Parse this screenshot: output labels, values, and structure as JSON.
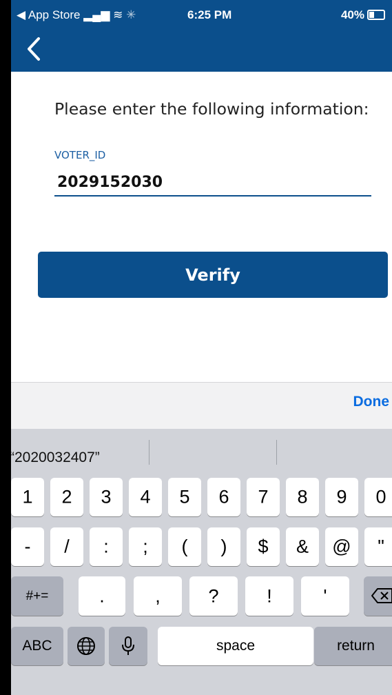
{
  "status_bar": {
    "back_app": "◀ App Store",
    "signal": "▂▄▆ ︎",
    "wifi": "wifi-icon",
    "time": "6:25 PM",
    "battery": "40%"
  },
  "form": {
    "prompt": "Please enter the following information:",
    "field_label": "VOTER_ID",
    "field_value": "2029152030",
    "verify_label": "Verify"
  },
  "accessory": {
    "done_label": "Done"
  },
  "keyboard": {
    "suggestion": "“2020032407”",
    "row1": [
      "1",
      "2",
      "3",
      "4",
      "5",
      "6",
      "7",
      "8",
      "9",
      "0"
    ],
    "row2": [
      "-",
      "/",
      ":",
      ";",
      "(",
      ")",
      "$",
      "&",
      "@",
      "\""
    ],
    "row3": {
      "shift": "#+=",
      "keys": [
        ".",
        ",",
        "?",
        "!",
        "'"
      ]
    },
    "row4": {
      "abc": "ABC",
      "space": "space",
      "return": "return"
    }
  },
  "colors": {
    "brand": "#0b4f8c",
    "label_blue": "#1c5fa3",
    "done_blue": "#0a6ce0"
  }
}
